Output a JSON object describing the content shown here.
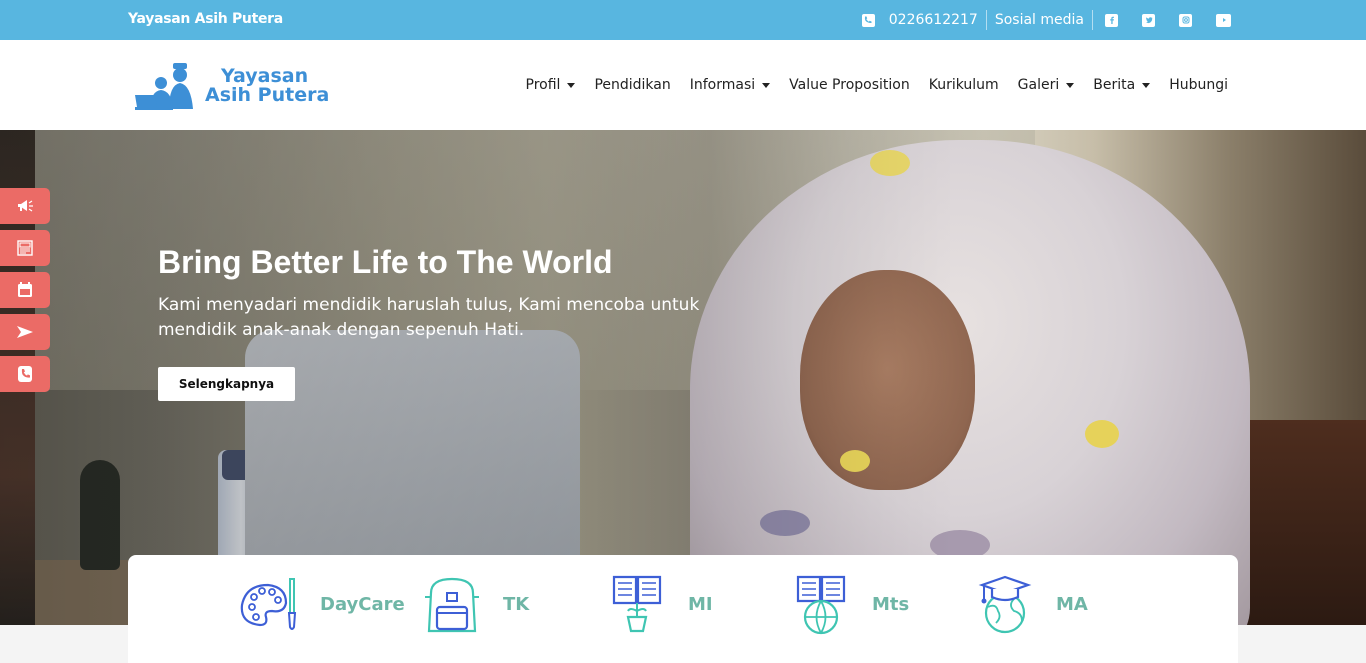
{
  "topbar": {
    "site_name": "Yayasan Asih Putera",
    "phone": "0226612217",
    "social_label": "Sosial media",
    "social_icons": [
      "facebook-icon",
      "twitter-icon",
      "instagram-icon",
      "youtube-icon"
    ]
  },
  "logo": {
    "line1": "Yayasan",
    "line2": "Asih Putera"
  },
  "menu": [
    {
      "label": "Profil",
      "dropdown": true
    },
    {
      "label": "Pendidikan",
      "dropdown": false
    },
    {
      "label": "Informasi",
      "dropdown": true
    },
    {
      "label": "Value Proposition",
      "dropdown": false
    },
    {
      "label": "Kurikulum",
      "dropdown": false
    },
    {
      "label": "Galeri",
      "dropdown": true
    },
    {
      "label": "Berita",
      "dropdown": true
    },
    {
      "label": "Hubungi",
      "dropdown": false
    }
  ],
  "hero": {
    "title": "Bring Better Life to The World",
    "text": "Kami menyadari mendidik haruslah tulus, Kami mencoba untuk mendidik anak-anak dengan sepenuh Hati.",
    "button": "Selengkapnya"
  },
  "side_buttons": [
    "megaphone-icon",
    "news-icon",
    "calendar-icon",
    "paper-plane-icon",
    "phone-icon"
  ],
  "programs": [
    {
      "label": "DayCare",
      "icon": "palette-icon"
    },
    {
      "label": "TK",
      "icon": "backpack-icon"
    },
    {
      "label": "MI",
      "icon": "book-plant-icon"
    },
    {
      "label": "Mts",
      "icon": "book-globe-icon"
    },
    {
      "label": "MA",
      "icon": "graduation-globe-icon"
    }
  ],
  "colors": {
    "topbar": "#58b6e0",
    "side_button": "#eb6b66",
    "program_label": "#6fb6a6",
    "icon_blue": "#3d5fd6",
    "icon_teal": "#3fc5b2"
  }
}
